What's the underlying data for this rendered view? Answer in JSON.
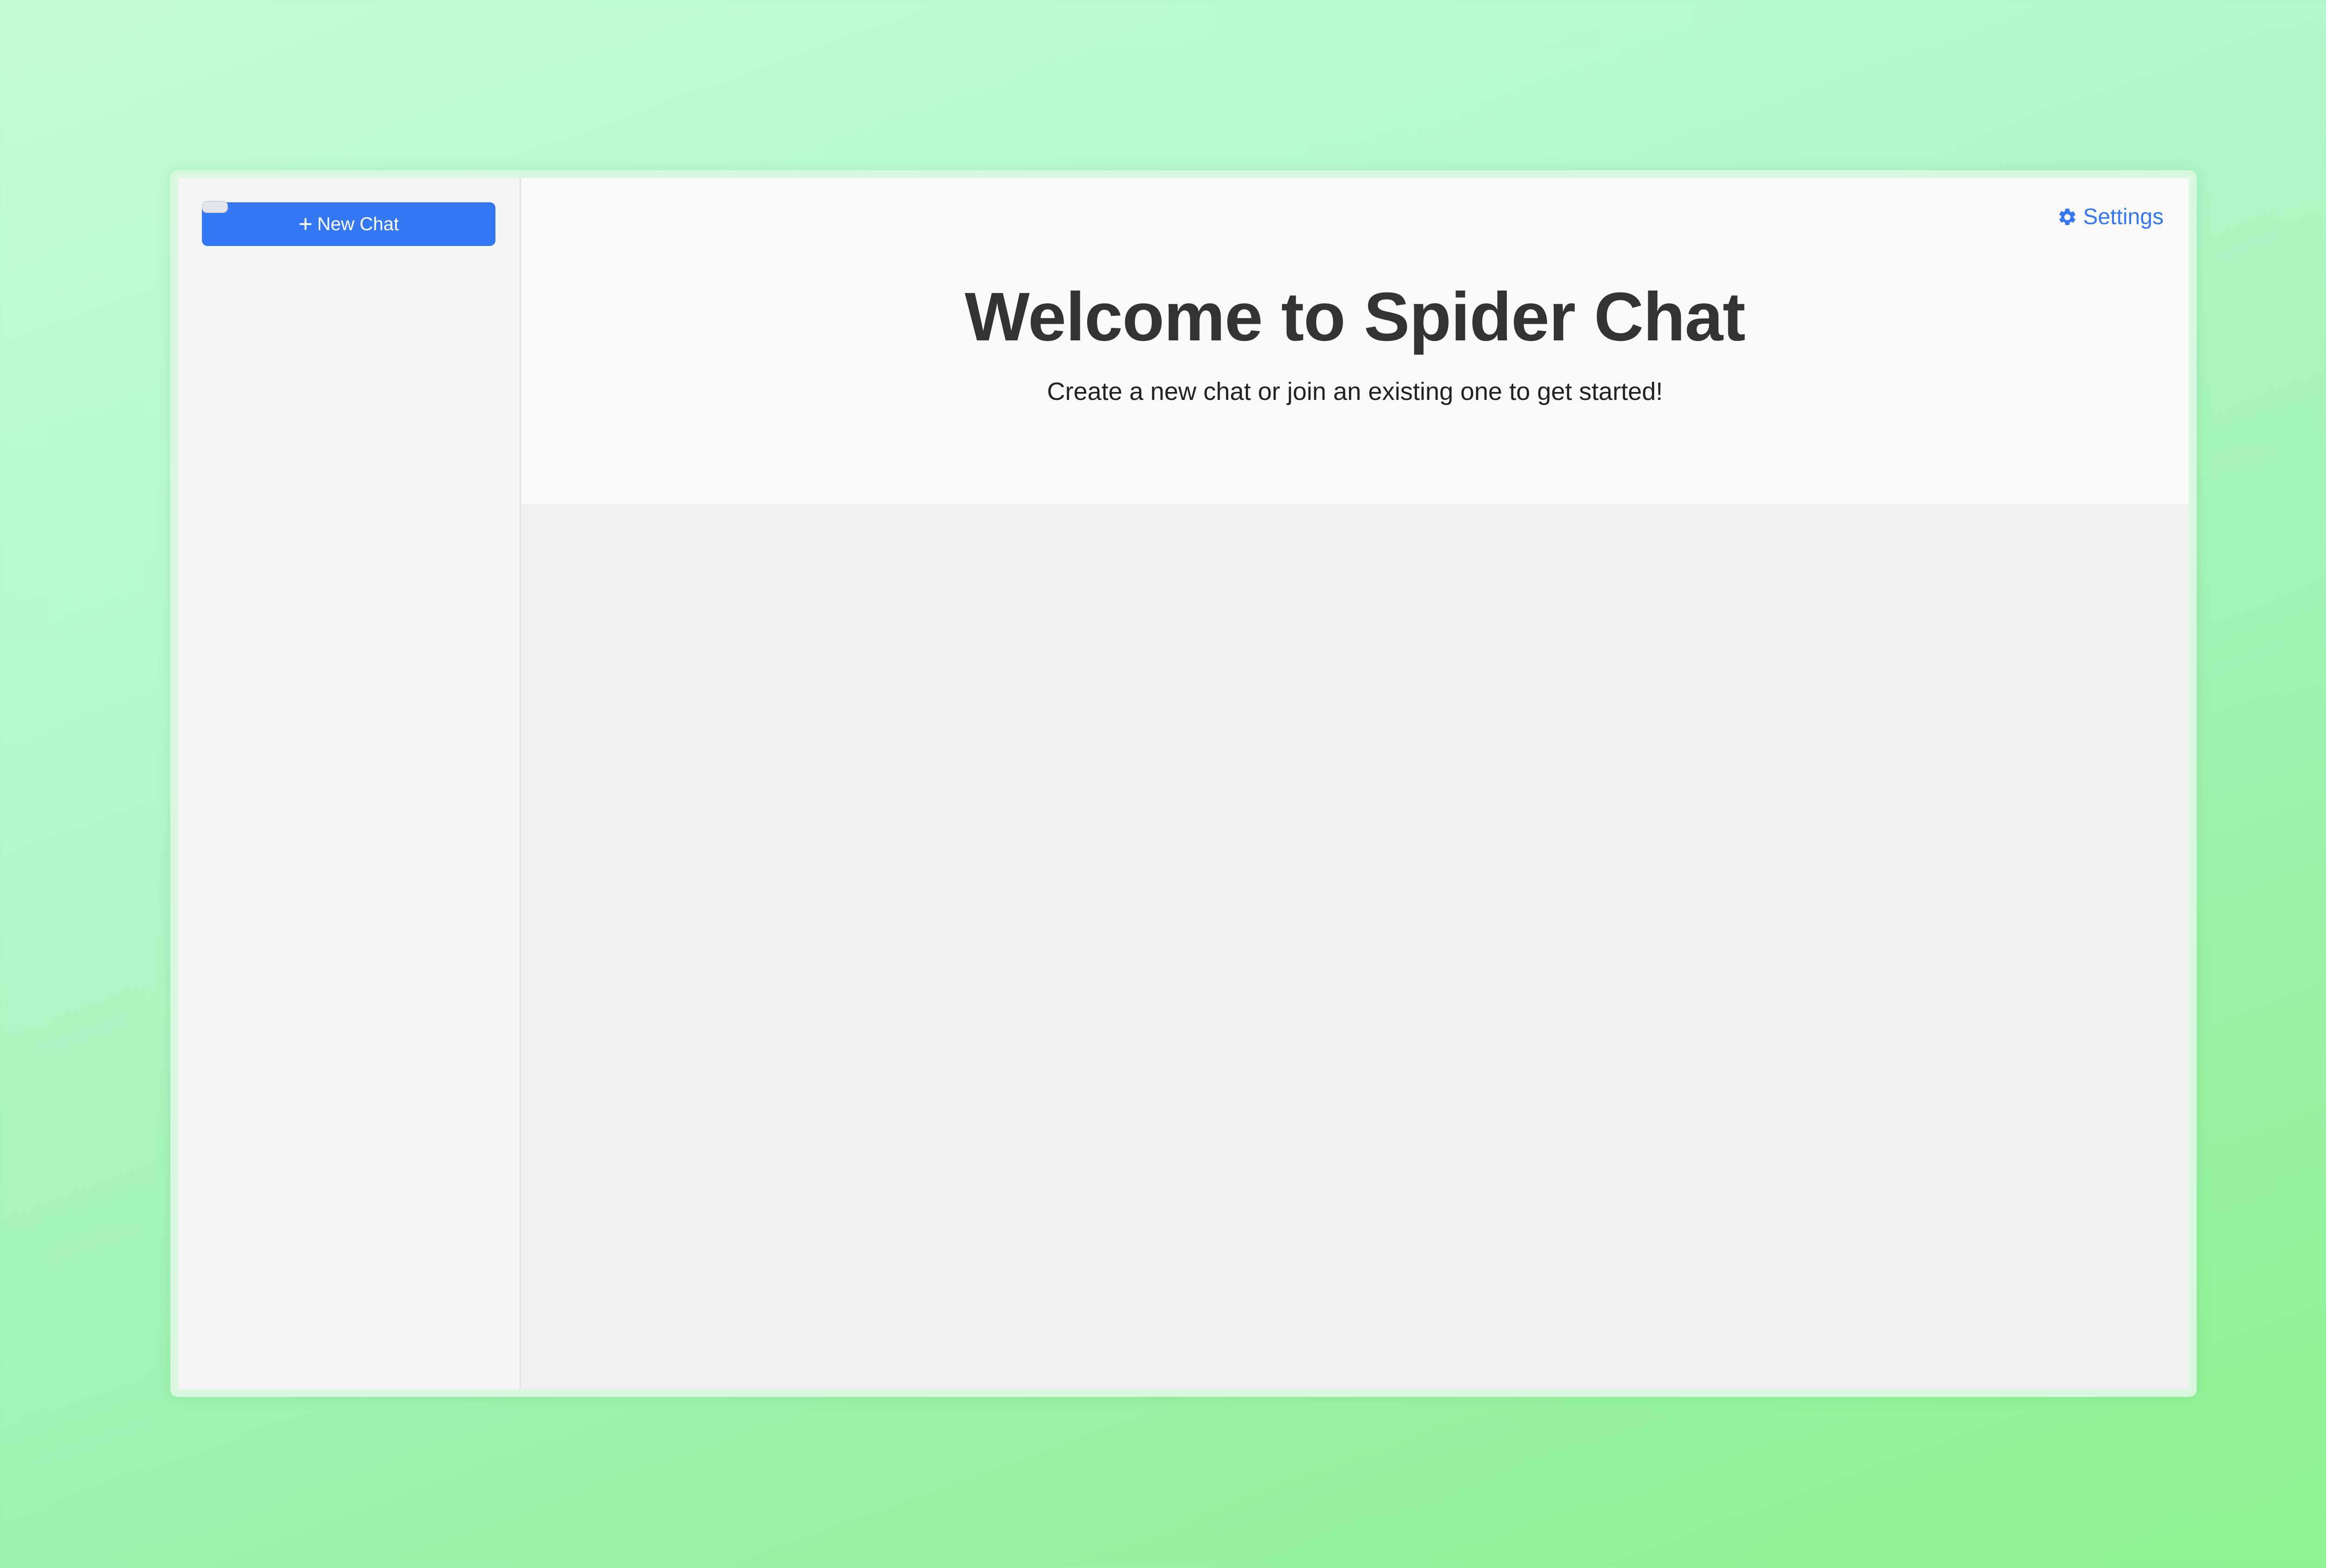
{
  "app": {
    "name": "Spider Chat"
  },
  "sidebar": {
    "new_chat_label": "New Chat",
    "new_chat_icon": "plus-icon"
  },
  "header": {
    "settings_label": "Settings",
    "settings_icon": "gear-icon",
    "title": "Welcome to Spider Chat",
    "subtitle": "Create a new chat or join an existing one to get started!"
  },
  "colors": {
    "accent": "#3478f6",
    "title_text": "#333333",
    "background_gradient_start": "#c5fdd2",
    "background_gradient_end": "#8ef290"
  }
}
